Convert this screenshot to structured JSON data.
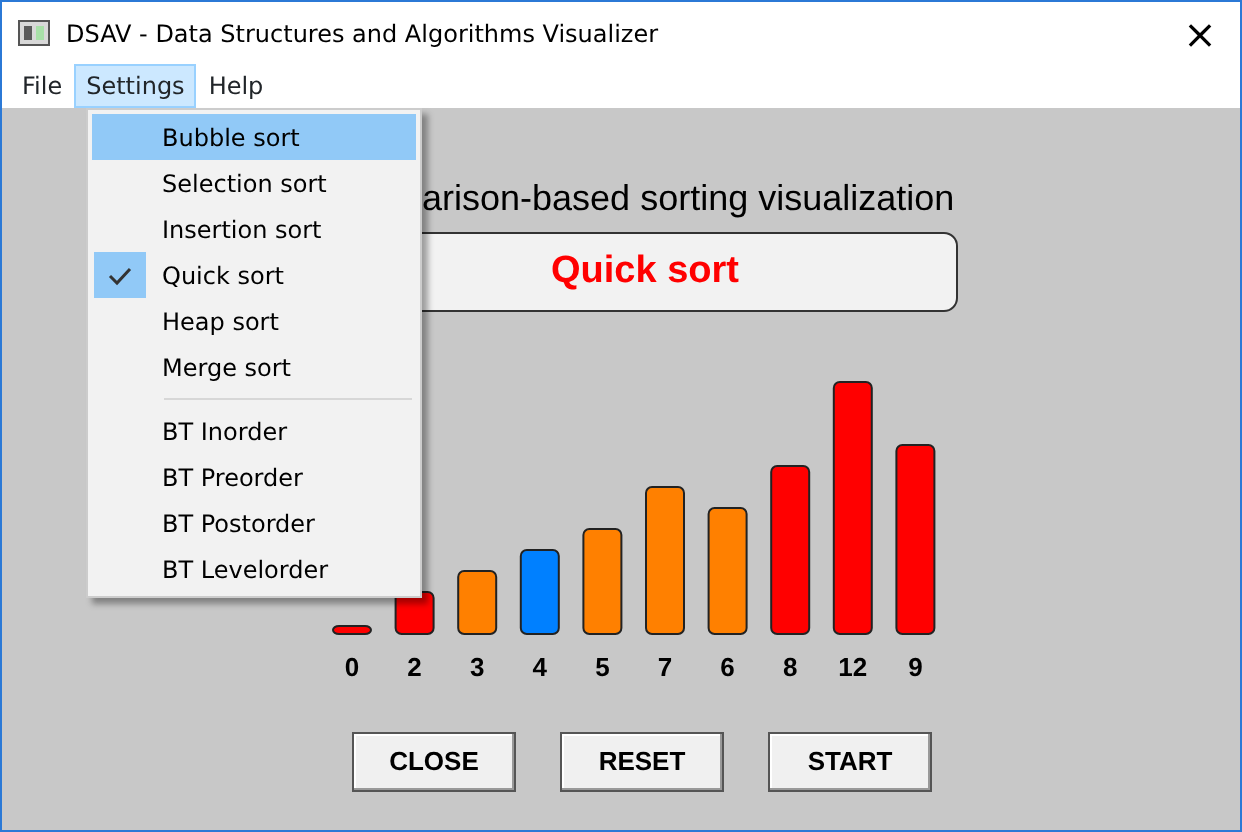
{
  "window": {
    "title": "DSAV - Data Structures and Algorithms Visualizer",
    "close": "×"
  },
  "menubar": [
    {
      "label": "File",
      "selected": false
    },
    {
      "label": "Settings",
      "selected": true
    },
    {
      "label": "Help",
      "selected": false
    }
  ],
  "open_menu": {
    "groups": [
      [
        {
          "label": "Bubble sort",
          "selected": true,
          "checked": false
        },
        {
          "label": "Selection sort",
          "selected": false,
          "checked": false
        },
        {
          "label": "Insertion sort",
          "selected": false,
          "checked": false
        },
        {
          "label": "Quick sort",
          "selected": false,
          "checked": true
        },
        {
          "label": "Heap sort",
          "selected": false,
          "checked": false
        },
        {
          "label": "Merge sort",
          "selected": false,
          "checked": false
        }
      ],
      [
        {
          "label": "BT Inorder",
          "selected": false,
          "checked": false
        },
        {
          "label": "BT Preorder",
          "selected": false,
          "checked": false
        },
        {
          "label": "BT Postorder",
          "selected": false,
          "checked": false
        },
        {
          "label": "BT Levelorder",
          "selected": false,
          "checked": false
        }
      ]
    ]
  },
  "heading": "arison-based sorting visualization",
  "algorithm": "Quick sort",
  "bars": [
    {
      "label": "0",
      "color": "#ff0000"
    },
    {
      "label": "2",
      "color": "#ff0000"
    },
    {
      "label": "3",
      "color": "#ff8000"
    },
    {
      "label": "4",
      "color": "#0080ff"
    },
    {
      "label": "5",
      "color": "#ff8000"
    },
    {
      "label": "7",
      "color": "#ff8000"
    },
    {
      "label": "6",
      "color": "#ff8000"
    },
    {
      "label": "8",
      "color": "#ff0000"
    },
    {
      "label": "12",
      "color": "#ff0000"
    },
    {
      "label": "9",
      "color": "#ff0000"
    }
  ],
  "buttons": [
    "CLOSE",
    "RESET",
    "START"
  ]
}
